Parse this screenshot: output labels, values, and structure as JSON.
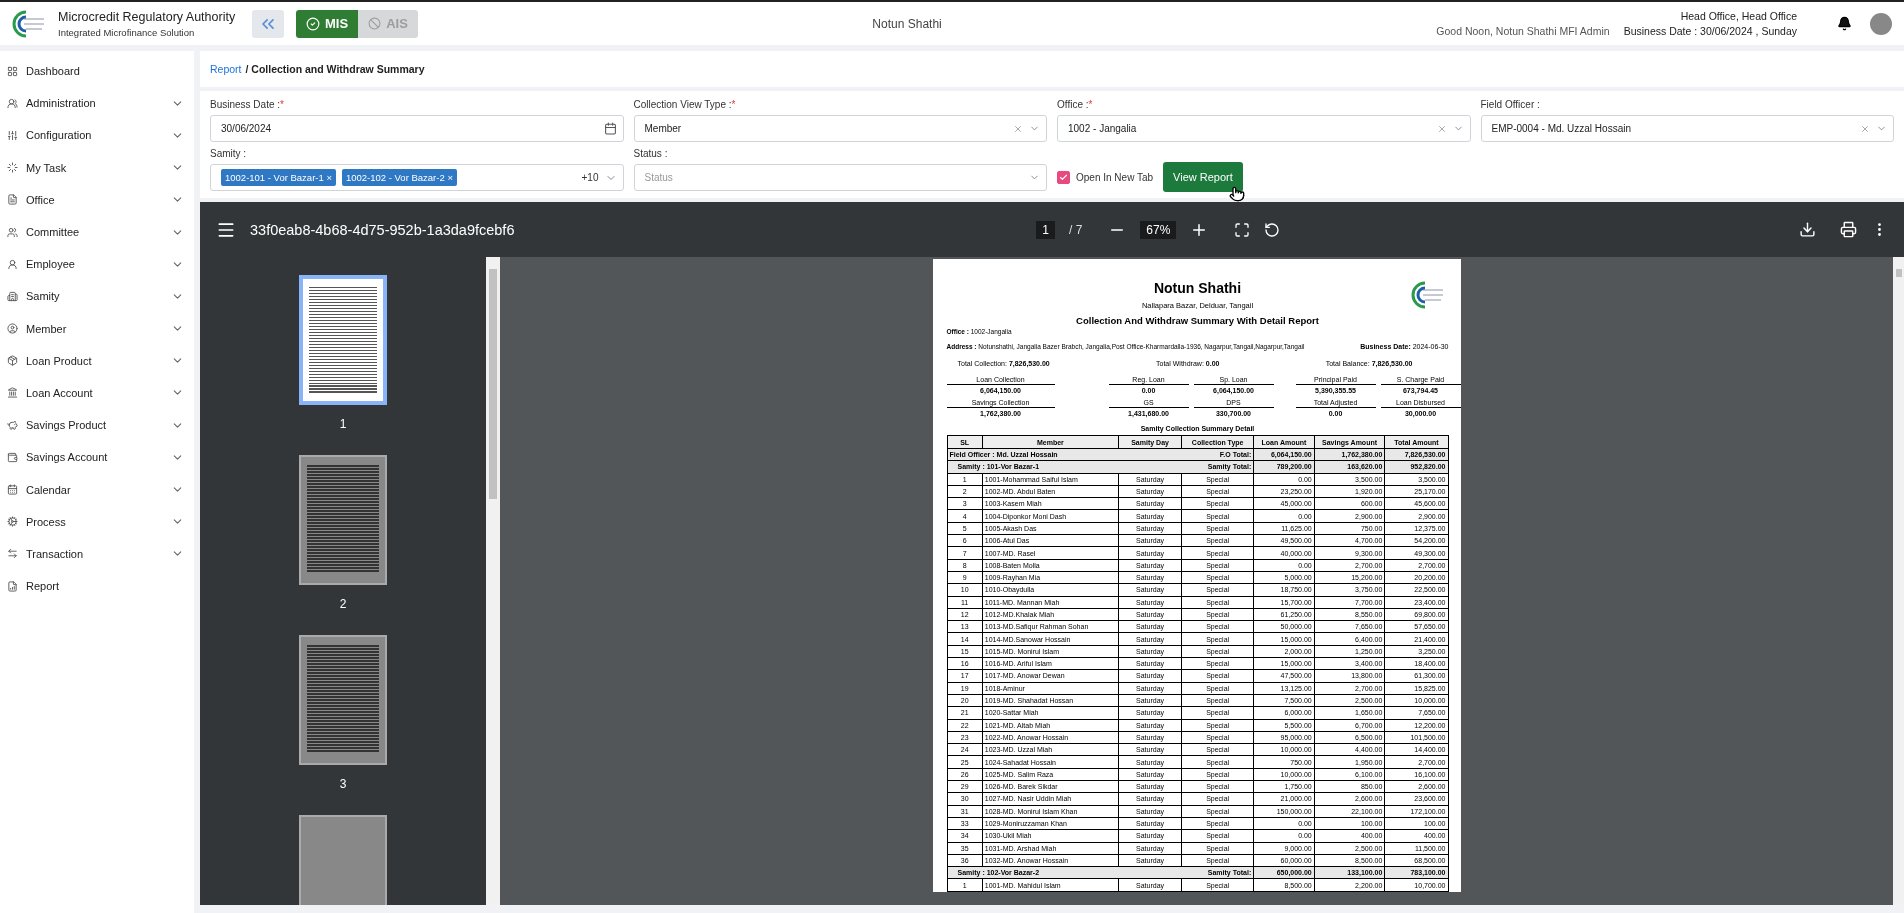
{
  "header": {
    "title": "Microcredit Regulatory Authority",
    "subtitle": "Integrated Microfinance Solution",
    "modes": [
      {
        "label": "MIS",
        "selected": true
      },
      {
        "label": "AIS",
        "selected": false
      }
    ],
    "organization": "Notun Shathi",
    "office": "Head Office, Head Office",
    "greeting": "Good Noon, Notun Shathi MFI Admin",
    "business_date": "Business Date : 30/06/2024 , Sunday"
  },
  "sidebar": {
    "items": [
      {
        "label": "Dashboard",
        "expandable": false
      },
      {
        "label": "Administration",
        "expandable": true
      },
      {
        "label": "Configuration",
        "expandable": true
      },
      {
        "label": "My Task",
        "expandable": true
      },
      {
        "label": "Office",
        "expandable": true
      },
      {
        "label": "Committee",
        "expandable": true
      },
      {
        "label": "Employee",
        "expandable": true
      },
      {
        "label": "Samity",
        "expandable": true
      },
      {
        "label": "Member",
        "expandable": true
      },
      {
        "label": "Loan Product",
        "expandable": true
      },
      {
        "label": "Loan Account",
        "expandable": true
      },
      {
        "label": "Savings Product",
        "expandable": true
      },
      {
        "label": "Savings Account",
        "expandable": true
      },
      {
        "label": "Calendar",
        "expandable": true
      },
      {
        "label": "Process",
        "expandable": true
      },
      {
        "label": "Transaction",
        "expandable": true
      },
      {
        "label": "Report",
        "expandable": false
      }
    ]
  },
  "breadcrumb": {
    "link": "Report",
    "separator": "/",
    "current": "Collection and Withdraw Summary"
  },
  "filters": {
    "fields": [
      {
        "kind": "date",
        "label": "Business Date :",
        "required_mark": "*",
        "value": "30/06/2024"
      },
      {
        "kind": "select",
        "label": "Collection View Type :",
        "required_mark": "*",
        "value": "Member",
        "clearable": true
      },
      {
        "kind": "select",
        "label": "Office :",
        "required_mark": "*",
        "value": "1002 - Jangalia",
        "clearable": true
      },
      {
        "kind": "select",
        "label": "Field Officer :",
        "value": "EMP-0004 - Md. Uzzal Hossain",
        "clearable": true
      },
      {
        "kind": "tags",
        "label": "Samity :",
        "tags": [
          {
            "label": "1002-101 - Vor Bazar-1",
            "remove": "×"
          },
          {
            "label": "1002-102 - Vor Bazar-2",
            "remove": "×"
          }
        ],
        "more": "+10"
      },
      {
        "kind": "select",
        "label": "Status :",
        "placeholder": "Status",
        "clearable": false
      }
    ],
    "open_new_tab": {
      "label": "Open In New Tab",
      "checked": true
    },
    "submit": "View Report"
  },
  "viewer": {
    "file_name": "33f0eab8-4b68-4d75-952b-1a3da9fcebf6",
    "page": "1",
    "page_count": "/ 7",
    "zoom": "67%",
    "thumbnails": [
      {
        "label": "1",
        "selected": true
      },
      {
        "label": "2",
        "selected": false
      },
      {
        "label": "3",
        "selected": false
      }
    ]
  },
  "report": {
    "title": "Notun Shathi",
    "location": "Nallapara Bazar, Delduar, Tangail",
    "heading": "Collection And Withdraw Summary With Detail Report",
    "office_label": "Office :",
    "office": "1002-Jangalia",
    "address_label": "Address :",
    "address": "Notunshathi, Jangalia Bazer Brabch, Jangalia,Post Office-Kharmardalla-1936, Nagarpur,Tangail,Nagarpur,Tangail",
    "date_label": "Business Date:",
    "date": "2024-06-30",
    "totals": [
      {
        "label": "Total Collection:",
        "value": "7,826,530.00"
      },
      {
        "label": "Total Withdraw:",
        "value": "0.00"
      },
      {
        "label": "Total Balance:",
        "value": "7,826,530.00"
      }
    ],
    "summary": [
      [
        {
          "label": "Loan Collection",
          "value": "6,064,150.00"
        },
        {
          "label": "Reg. Loan",
          "value": "0.00"
        },
        {
          "label": "Sp. Loan",
          "value": "6,064,150.00"
        },
        {
          "label": "Principal Paid",
          "value": "5,390,355.55"
        },
        {
          "label": "S. Charge Paid",
          "value": "673,794.45"
        }
      ],
      [
        {
          "label": "Savings Collection",
          "value": "1,762,380.00"
        },
        {
          "label": "GS",
          "value": "1,431,680.00"
        },
        {
          "label": "DPS",
          "value": "330,700.00"
        },
        {
          "label": "Total Adjusted",
          "value": "0.00"
        },
        {
          "label": "Loan Disbursed",
          "value": "30,000.00"
        }
      ]
    ],
    "table_title": "Samity Collection Summary Detail",
    "columns": [
      "SL",
      "Member",
      "Samity Day",
      "Collection Type",
      "Loan Amount",
      "Savings Amount",
      "Total Amount"
    ],
    "rows": [
      {
        "kind": "group",
        "name": "Field Officer : Md. Uzzal Hossain",
        "total_label": "F.O Total:",
        "values": [
          "6,064,150.00",
          "1,762,380.00",
          "7,826,530.00"
        ]
      },
      {
        "kind": "subgroup",
        "name": "Samity : 101-Vor Bazar-1",
        "total_label": "Samity Total:",
        "values": [
          "789,200.00",
          "163,620.00",
          "952,820.00"
        ]
      },
      {
        "kind": "member",
        "cells": [
          "1",
          "1001-Mohammad Saiful Islam",
          "Saturday",
          "Special",
          "0.00",
          "3,500.00",
          "3,500.00"
        ]
      },
      {
        "kind": "member",
        "cells": [
          "2",
          "1002-MD. Abdul Baten",
          "Saturday",
          "Special",
          "23,250.00",
          "1,920.00",
          "25,170.00"
        ]
      },
      {
        "kind": "member",
        "cells": [
          "3",
          "1003-Kasem Miah",
          "Saturday",
          "Special",
          "45,000.00",
          "600.00",
          "45,600.00"
        ]
      },
      {
        "kind": "member",
        "cells": [
          "4",
          "1004-Diponkor Moni Dash",
          "Saturday",
          "Special",
          "0.00",
          "2,900.00",
          "2,900.00"
        ]
      },
      {
        "kind": "member",
        "cells": [
          "5",
          "1005-Akash Das",
          "Saturday",
          "Special",
          "11,625.00",
          "750.00",
          "12,375.00"
        ]
      },
      {
        "kind": "member",
        "cells": [
          "6",
          "1006-Atul Das",
          "Saturday",
          "Special",
          "49,500.00",
          "4,700.00",
          "54,200.00"
        ]
      },
      {
        "kind": "member",
        "cells": [
          "7",
          "1007-MD. Rasel",
          "Saturday",
          "Special",
          "40,000.00",
          "9,300.00",
          "49,300.00"
        ]
      },
      {
        "kind": "member",
        "cells": [
          "8",
          "1008-Baten Molla",
          "Saturday",
          "Special",
          "0.00",
          "2,700.00",
          "2,700.00"
        ]
      },
      {
        "kind": "member",
        "cells": [
          "9",
          "1009-Rayhan Mia",
          "Saturday",
          "Special",
          "5,000.00",
          "15,200.00",
          "20,200.00"
        ]
      },
      {
        "kind": "member",
        "cells": [
          "10",
          "1010-Obaydulla",
          "Saturday",
          "Special",
          "18,750.00",
          "3,750.00",
          "22,500.00"
        ]
      },
      {
        "kind": "member",
        "cells": [
          "11",
          "1011-MD. Mannan Miah",
          "Saturday",
          "Special",
          "15,700.00",
          "7,700.00",
          "23,400.00"
        ]
      },
      {
        "kind": "member",
        "cells": [
          "12",
          "1012-MD.Khalak Miah",
          "Saturday",
          "Special",
          "61,250.00",
          "8,550.00",
          "69,800.00"
        ]
      },
      {
        "kind": "member",
        "cells": [
          "13",
          "1013-MD.Safiqur Rahman Sohan",
          "Saturday",
          "Special",
          "50,000.00",
          "7,650.00",
          "57,650.00"
        ]
      },
      {
        "kind": "member",
        "cells": [
          "14",
          "1014-MD.Sanowar Hossain",
          "Saturday",
          "Special",
          "15,000.00",
          "6,400.00",
          "21,400.00"
        ]
      },
      {
        "kind": "member",
        "cells": [
          "15",
          "1015-MD. Monirul Islam",
          "Saturday",
          "Special",
          "2,000.00",
          "1,250.00",
          "3,250.00"
        ]
      },
      {
        "kind": "member",
        "cells": [
          "16",
          "1016-MD. Ariful Islam",
          "Saturday",
          "Special",
          "15,000.00",
          "3,400.00",
          "18,400.00"
        ]
      },
      {
        "kind": "member",
        "cells": [
          "17",
          "1017-MD. Anowar Dewan",
          "Saturday",
          "Special",
          "47,500.00",
          "13,800.00",
          "61,300.00"
        ]
      },
      {
        "kind": "member",
        "cells": [
          "19",
          "1018-Aminur",
          "Saturday",
          "Special",
          "13,125.00",
          "2,700.00",
          "15,825.00"
        ]
      },
      {
        "kind": "member",
        "cells": [
          "20",
          "1019-MD. Shahadat Hossan",
          "Saturday",
          "Special",
          "7,500.00",
          "2,500.00",
          "10,000.00"
        ]
      },
      {
        "kind": "member",
        "cells": [
          "21",
          "1020-Sattar Miah",
          "Saturday",
          "Special",
          "6,000.00",
          "1,650.00",
          "7,650.00"
        ]
      },
      {
        "kind": "member",
        "cells": [
          "22",
          "1021-MD. Altab Miah",
          "Saturday",
          "Special",
          "5,500.00",
          "6,700.00",
          "12,200.00"
        ]
      },
      {
        "kind": "member",
        "cells": [
          "23",
          "1022-MD. Anowar Hossain",
          "Saturday",
          "Special",
          "95,000.00",
          "6,500.00",
          "101,500.00"
        ]
      },
      {
        "kind": "member",
        "cells": [
          "24",
          "1023-MD. Uzzal Miah",
          "Saturday",
          "Special",
          "10,000.00",
          "4,400.00",
          "14,400.00"
        ]
      },
      {
        "kind": "member",
        "cells": [
          "25",
          "1024-Sahadat Hossain",
          "Saturday",
          "Special",
          "750.00",
          "1,950.00",
          "2,700.00"
        ]
      },
      {
        "kind": "member",
        "cells": [
          "26",
          "1025-MD. Salim Raza",
          "Saturday",
          "Special",
          "10,000.00",
          "6,100.00",
          "16,100.00"
        ]
      },
      {
        "kind": "member",
        "cells": [
          "29",
          "1026-MD. Barek Sikdar",
          "Saturday",
          "Special",
          "1,750.00",
          "850.00",
          "2,600.00"
        ]
      },
      {
        "kind": "member",
        "cells": [
          "30",
          "1027-MD. Nasir Uddin Miah",
          "Saturday",
          "Special",
          "21,000.00",
          "2,600.00",
          "23,600.00"
        ]
      },
      {
        "kind": "member",
        "cells": [
          "31",
          "1028-MD. Monirul Islam Khan",
          "Saturday",
          "Special",
          "150,000.00",
          "22,100.00",
          "172,100.00"
        ]
      },
      {
        "kind": "member",
        "cells": [
          "33",
          "1029-Moniruzzaman Khan",
          "Saturday",
          "Special",
          "0.00",
          "100.00",
          "100.00"
        ]
      },
      {
        "kind": "member",
        "cells": [
          "34",
          "1030-Ukil Miah",
          "Saturday",
          "Special",
          "0.00",
          "400.00",
          "400.00"
        ]
      },
      {
        "kind": "member",
        "cells": [
          "35",
          "1031-MD. Arshad Miah",
          "Saturday",
          "Special",
          "9,000.00",
          "2,500.00",
          "11,500.00"
        ]
      },
      {
        "kind": "member",
        "cells": [
          "36",
          "1032-MD. Anowar Hossain",
          "Saturday",
          "Special",
          "60,000.00",
          "8,500.00",
          "68,500.00"
        ]
      },
      {
        "kind": "subgroup",
        "name": "Samity : 102-Vor Bazar-2",
        "total_label": "Samity Total:",
        "values": [
          "650,000.00",
          "133,100.00",
          "783,100.00"
        ]
      },
      {
        "kind": "member",
        "cells": [
          "1",
          "1001-MD. Mahidul Islam",
          "Saturday",
          "Special",
          "8,500.00",
          "2,200.00",
          "10,700.00"
        ]
      }
    ]
  }
}
